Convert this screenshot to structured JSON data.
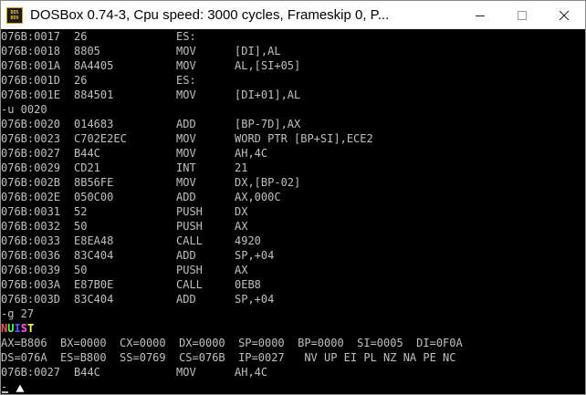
{
  "window": {
    "title": "DOSBox 0.74-3, Cpu speed:     3000 cycles, Frameskip  0, P...",
    "icon_label_top": "DOS",
    "icon_label_bottom": "BOX",
    "icon": "dosbox-icon"
  },
  "controls": {
    "minimize": "minimize-icon",
    "maximize": "maximize-icon",
    "close": "close-icon"
  },
  "colors": {
    "screen_bg": "#000000",
    "text": "#c0c0c0",
    "nuist_n": "#ff5555",
    "nuist_u": "#55ff55",
    "nuist_i": "#5555ff",
    "nuist_s": "#ff55ff",
    "nuist_t": "#ffff55"
  },
  "console": {
    "disasm1": [
      {
        "addr": "076B:0017",
        "hex": "26",
        "mn": "ES:",
        "op": ""
      },
      {
        "addr": "076B:0018",
        "hex": "8805",
        "mn": "MOV",
        "op": "[DI],AL"
      },
      {
        "addr": "076B:001A",
        "hex": "8A4405",
        "mn": "MOV",
        "op": "AL,[SI+05]"
      },
      {
        "addr": "076B:001D",
        "hex": "26",
        "mn": "ES:",
        "op": ""
      },
      {
        "addr": "076B:001E",
        "hex": "884501",
        "mn": "MOV",
        "op": "[DI+01],AL"
      }
    ],
    "cmd_u": "-u 0020",
    "disasm2": [
      {
        "addr": "076B:0020",
        "hex": "014683",
        "mn": "ADD",
        "op": "[BP-7D],AX"
      },
      {
        "addr": "076B:0023",
        "hex": "C702E2EC",
        "mn": "MOV",
        "op": "WORD PTR [BP+SI],ECE2"
      },
      {
        "addr": "076B:0027",
        "hex": "B44C",
        "mn": "MOV",
        "op": "AH,4C"
      },
      {
        "addr": "076B:0029",
        "hex": "CD21",
        "mn": "INT",
        "op": "21"
      },
      {
        "addr": "076B:002B",
        "hex": "8B56FE",
        "mn": "MOV",
        "op": "DX,[BP-02]"
      },
      {
        "addr": "076B:002E",
        "hex": "050C00",
        "mn": "ADD",
        "op": "AX,000C"
      },
      {
        "addr": "076B:0031",
        "hex": "52",
        "mn": "PUSH",
        "op": "DX"
      },
      {
        "addr": "076B:0032",
        "hex": "50",
        "mn": "PUSH",
        "op": "AX"
      },
      {
        "addr": "076B:0033",
        "hex": "E8EA48",
        "mn": "CALL",
        "op": "4920"
      },
      {
        "addr": "076B:0036",
        "hex": "83C404",
        "mn": "ADD",
        "op": "SP,+04"
      },
      {
        "addr": "076B:0039",
        "hex": "50",
        "mn": "PUSH",
        "op": "AX"
      },
      {
        "addr": "076B:003A",
        "hex": "E87B0E",
        "mn": "CALL",
        "op": "0EB8"
      },
      {
        "addr": "076B:003D",
        "hex": "83C404",
        "mn": "ADD",
        "op": "SP,+04"
      }
    ],
    "cmd_g": "-g 27",
    "nuist": [
      "N",
      "U",
      "I",
      "S",
      "T"
    ],
    "regs1": "AX=B806  BX=0000  CX=0000  DX=0000  SP=0000  BP=0000  SI=0005  DI=0F0A",
    "regs2": "DS=076A  ES=B800  SS=0769  CS=076B  IP=0027   NV UP EI PL NZ NA PE NC",
    "current": {
      "addr": "076B:0027",
      "hex": "B44C",
      "mn": "MOV",
      "op": "AH,4C"
    },
    "prompt": "-"
  },
  "mouse": "mouse-pointer-icon"
}
